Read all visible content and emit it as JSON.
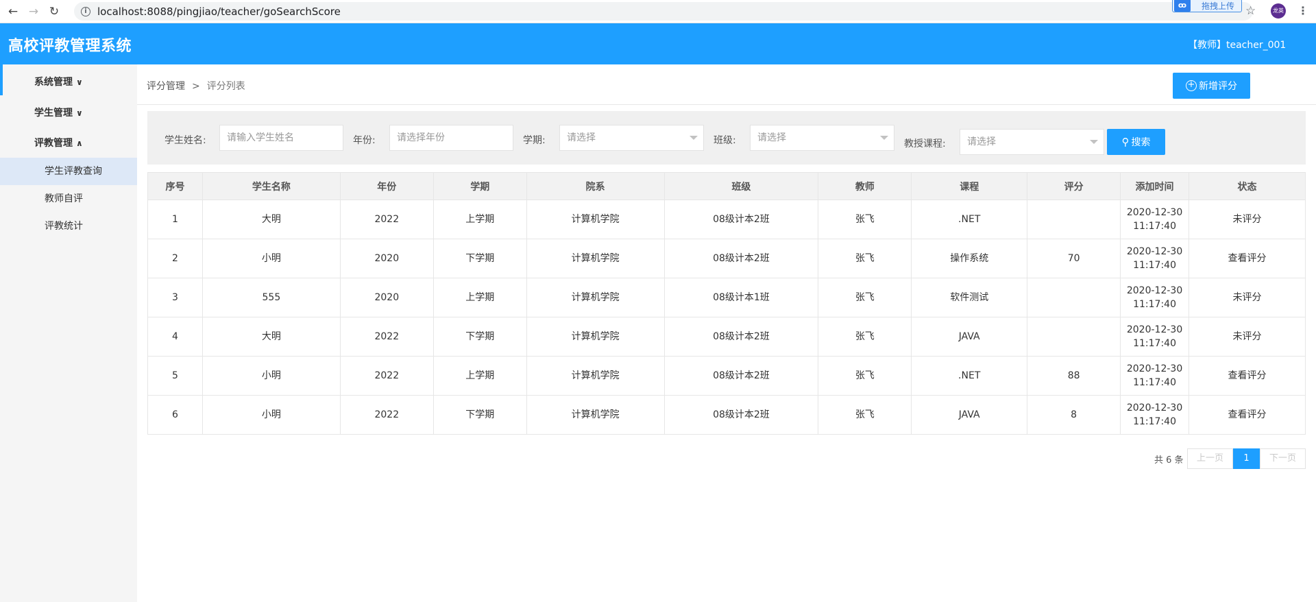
{
  "browser": {
    "url": "localhost:8088/pingjiao/teacher/goSearchScore",
    "extension_label": "拖拽上传",
    "profile_label": "龙英",
    "back_icon": "arrow-left",
    "forward_icon": "arrow-right",
    "reload_icon": "reload"
  },
  "header": {
    "title": "高校评教管理系统",
    "user": "【教师】teacher_001"
  },
  "sidebar": {
    "groups": [
      {
        "label": "系统管理",
        "expanded": false
      },
      {
        "label": "学生管理",
        "expanded": false
      },
      {
        "label": "评教管理",
        "expanded": true
      }
    ],
    "sub_items": [
      {
        "label": "学生评教查询",
        "selected": true
      },
      {
        "label": "教师自评",
        "selected": false
      },
      {
        "label": "评教统计",
        "selected": false
      }
    ]
  },
  "breadcrumb": {
    "parent": "评分管理",
    "separator": ">",
    "current": "评分列表"
  },
  "add_button_label": "新增评分",
  "filters": {
    "student_name_label": "学生姓名:",
    "student_name_placeholder": "请输入学生姓名",
    "year_label": "年份:",
    "year_placeholder": "请选择年份",
    "term_label": "学期:",
    "term_value": "请选择",
    "class_label": "班级:",
    "class_value": "请选择",
    "course_label": "教授课程:",
    "course_value": "请选择",
    "search_label": "搜索"
  },
  "table": {
    "columns": [
      "序号",
      "学生名称",
      "年份",
      "学期",
      "院系",
      "班级",
      "教师",
      "课程",
      "评分",
      "添加时间",
      "状态"
    ],
    "rows": [
      {
        "no": "1",
        "name": "大明",
        "year": "2022",
        "term": "上学期",
        "dept": "计算机学院",
        "class": "08级计本2班",
        "teacher": "张飞",
        "course": ".NET",
        "score": "",
        "date": "2020-12-30",
        "time": "11:17:40",
        "status": "未评分"
      },
      {
        "no": "2",
        "name": "小明",
        "year": "2020",
        "term": "下学期",
        "dept": "计算机学院",
        "class": "08级计本2班",
        "teacher": "张飞",
        "course": "操作系统",
        "score": "70",
        "date": "2020-12-30",
        "time": "11:17:40",
        "status": "查看评分"
      },
      {
        "no": "3",
        "name": "555",
        "year": "2020",
        "term": "上学期",
        "dept": "计算机学院",
        "class": "08级计本1班",
        "teacher": "张飞",
        "course": "软件测试",
        "score": "",
        "date": "2020-12-30",
        "time": "11:17:40",
        "status": "未评分"
      },
      {
        "no": "4",
        "name": "大明",
        "year": "2022",
        "term": "下学期",
        "dept": "计算机学院",
        "class": "08级计本2班",
        "teacher": "张飞",
        "course": "JAVA",
        "score": "",
        "date": "2020-12-30",
        "time": "11:17:40",
        "status": "未评分"
      },
      {
        "no": "5",
        "name": "小明",
        "year": "2022",
        "term": "上学期",
        "dept": "计算机学院",
        "class": "08级计本2班",
        "teacher": "张飞",
        "course": ".NET",
        "score": "88",
        "date": "2020-12-30",
        "time": "11:17:40",
        "status": "查看评分"
      },
      {
        "no": "6",
        "name": "小明",
        "year": "2022",
        "term": "下学期",
        "dept": "计算机学院",
        "class": "08级计本2班",
        "teacher": "张飞",
        "course": "JAVA",
        "score": "8",
        "date": "2020-12-30",
        "time": "11:17:40",
        "status": "查看评分"
      }
    ]
  },
  "pagination": {
    "total": "共 6 条",
    "prev": "上一页",
    "current": "1",
    "next": "下一页"
  },
  "colors": {
    "primary": "#1e9fff",
    "sidebar_bg": "#f5f5f5",
    "selected_bg": "#dde8f7"
  }
}
